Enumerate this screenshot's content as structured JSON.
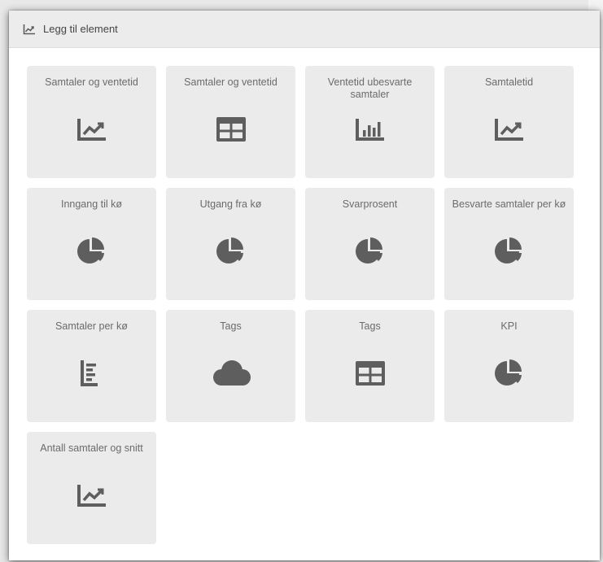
{
  "dialog": {
    "title": "Legg til element",
    "title_icon": "line-chart-icon"
  },
  "tiles": [
    {
      "label": "Samtaler og ventetid",
      "icon": "line-chart-icon"
    },
    {
      "label": "Samtaler og ventetid",
      "icon": "table-icon"
    },
    {
      "label": "Ventetid ubesvarte samtaler",
      "icon": "bar-chart-icon"
    },
    {
      "label": "Samtaletid",
      "icon": "line-chart-icon"
    },
    {
      "label": "Inngang til kø",
      "icon": "pie-chart-icon"
    },
    {
      "label": "Utgang fra kø",
      "icon": "pie-chart-icon"
    },
    {
      "label": "Svarprosent",
      "icon": "pie-chart-icon"
    },
    {
      "label": "Besvarte samtaler per kø",
      "icon": "pie-chart-icon"
    },
    {
      "label": "Samtaler per kø",
      "icon": "horizontal-bar-chart-icon"
    },
    {
      "label": "Tags",
      "icon": "cloud-icon"
    },
    {
      "label": "Tags",
      "icon": "table-icon"
    },
    {
      "label": "KPI",
      "icon": "pie-chart-icon"
    },
    {
      "label": "Antall samtaler og snitt",
      "icon": "line-chart-icon"
    }
  ],
  "colors": {
    "icon": "#5e5e5e",
    "tile_background": "#ebebeb",
    "header_background": "#ececec",
    "label_text": "#6b6b6b"
  }
}
